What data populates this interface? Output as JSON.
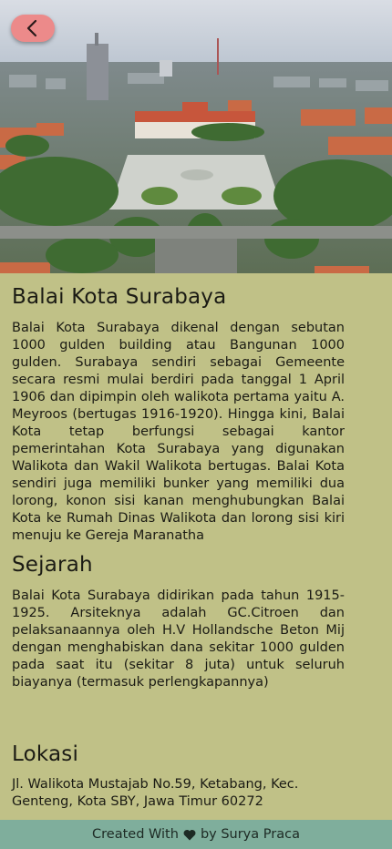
{
  "header": {
    "back_button_icon": "chevron-left-icon",
    "hero_image_alt": "Aerial view of Balai Kota Surabaya"
  },
  "main": {
    "title": "Balai Kota Surabaya",
    "description": "Balai Kota Surabaya dikenal dengan sebutan 1000 gulden building atau Bangunan 1000 gulden. Surabaya sendiri sebagai Gemeente secara resmi mulai berdiri pada tanggal 1 April 1906 dan dipimpin oleh walikota pertama yaitu A. Meyroos (bertugas 1916-1920). Hingga kini, Balai Kota tetap berfungsi sebagai kantor pemerintahan Kota Surabaya yang digunakan Walikota dan Wakil Walikota bertugas. Balai Kota sendiri juga memiliki bunker yang memiliki dua lorong, konon sisi kanan menghubungkan Balai Kota ke Rumah Dinas Walikota dan lorong sisi kiri menuju ke Gereja Maranatha",
    "history_heading": "Sejarah",
    "history_text": "Balai Kota Surabaya didirikan pada tahun 1915-1925. Arsiteknya adalah GC.Citroen dan pelaksanaannya oleh H.V Hollandsche Beton Mij dengan menghabiskan dana sekitar 1000 gulden pada saat itu (sekitar 8 juta) untuk seluruh biayanya (termasuk perlengkapannya)",
    "location_heading": "Lokasi",
    "location_text": "Jl. Walikota Mustajab No.59, Ketabang, Kec. Genteng, Kota SBY, Jawa Timur 60272"
  },
  "footer": {
    "prefix": "Created With",
    "heart_icon": "heart-icon",
    "suffix": "by Surya Praca"
  },
  "colors": {
    "background": "#c0c187",
    "footer": "#7fae9c",
    "back_button": "#ec8a8a"
  }
}
